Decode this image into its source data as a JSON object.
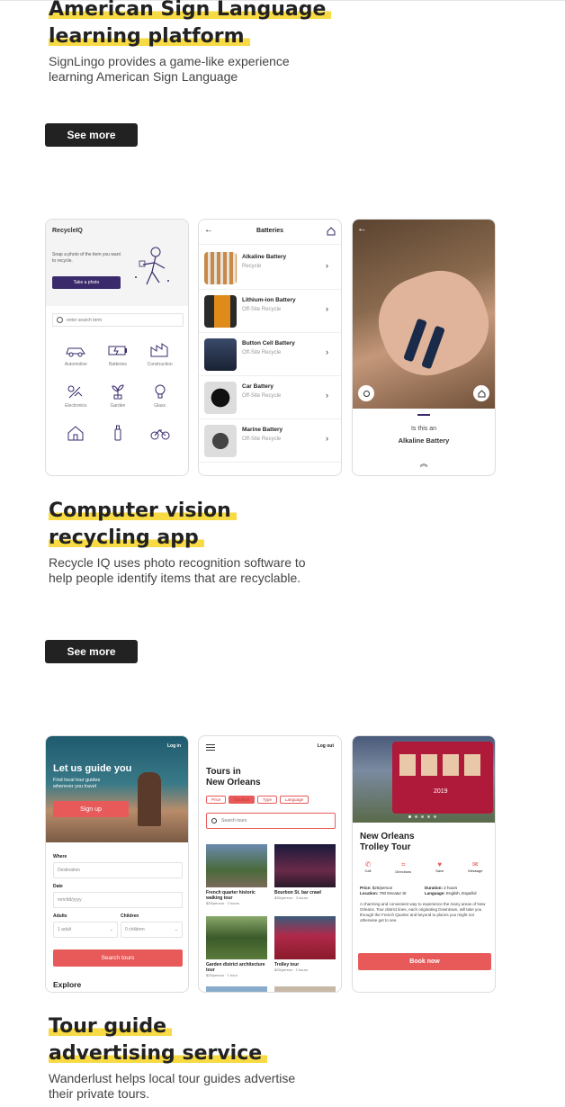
{
  "section1": {
    "title_line1": "American Sign Language",
    "title_line2": "learning platform",
    "description": "SignLingo provides a game-like experience learning American Sign Language",
    "button": "See more"
  },
  "section2": {
    "title_line1": "Computer vision",
    "title_line2": "recycling app",
    "description": "Recycle IQ uses photo recognition software to help people identify items that are recyclable.",
    "button": "See more",
    "phone1": {
      "app_name": "RecycleIQ",
      "prompt": "Snap a photo of the item you want to recycle.",
      "cta": "Take a photo",
      "search_placeholder": "enter search term",
      "categories": [
        "Automotive",
        "Batteries",
        "Construction",
        "Electronics",
        "Garden",
        "Glass"
      ]
    },
    "phone2": {
      "title": "Batteries",
      "items": [
        {
          "name": "Alkaline Battery",
          "status": "Recycle"
        },
        {
          "name": "Lithium-ion Battery",
          "status": "Off-Site Recycle"
        },
        {
          "name": "Button Cell Battery",
          "status": "Off-Site Recycle"
        },
        {
          "name": "Car Battery",
          "status": "Off-Site Recycle"
        },
        {
          "name": "Marine Battery",
          "status": "Off-Site Recycle"
        }
      ]
    },
    "phone3": {
      "question": "Is this an",
      "answer": "Alkaline Battery"
    }
  },
  "section3": {
    "title_line1": "Tour guide",
    "title_line2": "advertising service",
    "description": "Wanderlust helps local tour guides advertise their private tours.",
    "phone1": {
      "login": "Log in",
      "hero_title": "Let us guide you",
      "hero_sub": "Find local tour guides wherever you travel",
      "signup": "Sign up",
      "where_label": "Where",
      "where_placeholder": "Destination",
      "date_label": "Date",
      "date_placeholder": "mm/dd/yyyy",
      "adults_label": "Adults",
      "adults_value": "1 adult",
      "children_label": "Children",
      "children_value": "0 children",
      "search_button": "Search tours",
      "explore": "Explore"
    },
    "phone2": {
      "logout": "Log out",
      "title_line1": "Tours in",
      "title_line2": "New Orleans",
      "filters": [
        "Price",
        "Duration",
        "Type",
        "Language"
      ],
      "search_placeholder": "Search tours",
      "tours": [
        {
          "name": "French quarter historic walking tour",
          "meta": "$25/person · 2 hours"
        },
        {
          "name": "Bourbon St. bar crawl",
          "meta": "$35/person · 3 hours"
        },
        {
          "name": "Garden district architecture tour",
          "meta": "$25/person · 1 hour"
        },
        {
          "name": "Trolley tour",
          "meta": "$25/person · 2 hours"
        }
      ]
    },
    "phone3": {
      "title_line1": "New Orleans",
      "title_line2": "Trolley Tour",
      "actions": [
        "Call",
        "Directions",
        "Save",
        "Message"
      ],
      "price_label": "Price:",
      "price_value": "$25/person",
      "duration_label": "Duration:",
      "duration_value": "2 hours",
      "location_label": "Location:",
      "location_value": "700 Decatur St",
      "language_label": "Language:",
      "language_value": "English, Español",
      "body": "A charming and convenient way to experience the many areas of New Orleans. Tour district lines, each originating Downtown, will take you through the French Quarter and beyond to places you might not otherwise get to see.",
      "book": "Book now",
      "trolley_number": "2019"
    }
  },
  "colors": {
    "highlight": "#f7da44",
    "accent_purple": "#3a2a6b",
    "tour_red": "#e85a5a",
    "dark": "#222222"
  }
}
